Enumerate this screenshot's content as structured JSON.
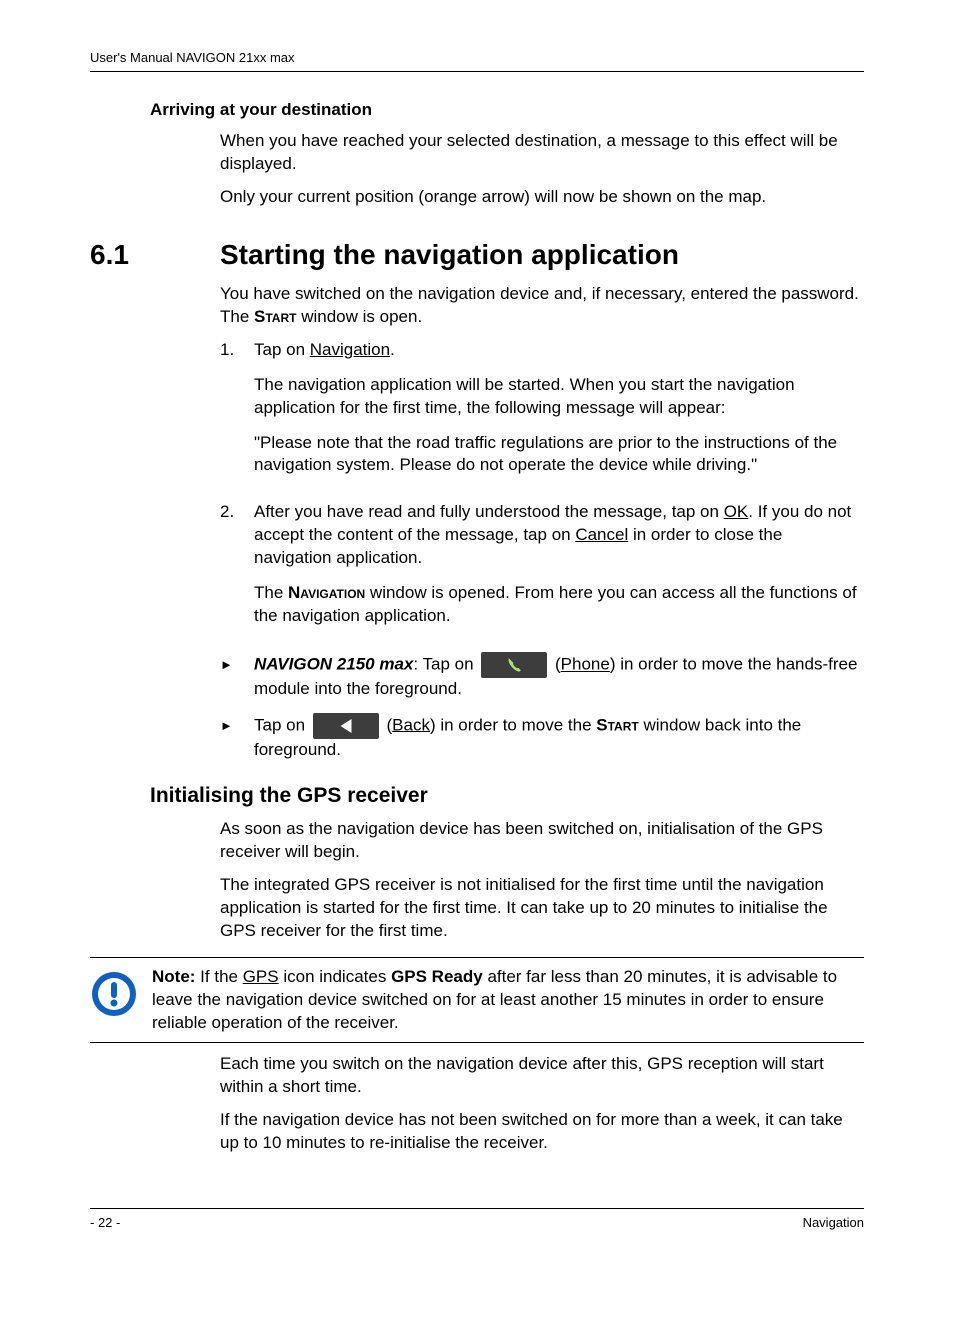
{
  "header": "User's Manual NAVIGON 21xx max",
  "s1": {
    "title": "Arriving at your destination",
    "p1": "When you have reached your selected destination, a message to this effect will be displayed.",
    "p2": "Only your current position (orange arrow) will now be shown on the map."
  },
  "s2": {
    "num": "6.1",
    "title": "Starting the navigation application",
    "intro_a": "You have switched on the navigation device and, if necessary, entered the password. The ",
    "intro_b": "Start",
    "intro_c": " window is open.",
    "step1_a": "Tap on ",
    "step1_b": "Navigation",
    "step1_c": ".",
    "step1_p1": "The navigation application will be started. When you start the navigation application for the first time, the following message will appear:",
    "step1_p2": "\"Please note that the road traffic regulations are prior to the instructions of the navigation system. Please do not operate the device while driving.\"",
    "step2_a": "After you have read and fully understood the message, tap on ",
    "step2_b": "OK",
    "step2_c": ". If you do not accept the content of the message, tap on ",
    "step2_d": "Cancel",
    "step2_e": " in order to close the navigation application.",
    "step2_p1a": "The ",
    "step2_p1b": "Navigation",
    "step2_p1c": " window is opened. From here you can access all the functions of the navigation application.",
    "b1_a": "NAVIGON 2150 max",
    "b1_b": ": Tap on ",
    "b1_c": " (",
    "b1_d": "Phone",
    "b1_e": ") in order to move the hands-free module into the foreground.",
    "b2_a": "Tap on ",
    "b2_b": " (",
    "b2_c": "Back",
    "b2_d": ") in order to move the ",
    "b2_e": "Start",
    "b2_f": " window back into the foreground."
  },
  "s3": {
    "title": "Initialising the GPS receiver",
    "p1": "As soon as the navigation device has been switched on, initialisation of the GPS receiver will begin.",
    "p2": "The integrated GPS receiver is not initialised for the first time until the navigation application is started for the first time. It can take up to 20 minutes to initialise the GPS receiver for the first time.",
    "note_a": "Note:",
    "note_b": " If the ",
    "note_c": "GPS",
    "note_d": " icon indicates ",
    "note_e": "GPS Ready",
    "note_f": " after far less than 20 minutes, it is advisable to leave the navigation device switched on for at least another 15 minutes in order to ensure reliable operation of the receiver.",
    "p3": "Each time you switch on the navigation device after this, GPS reception will start within a short time.",
    "p4": "If the navigation device has not been switched on for more than a week, it can take up to 10 minutes to re-initialise the receiver."
  },
  "footer": {
    "left": "- 22 -",
    "right": "Navigation"
  }
}
